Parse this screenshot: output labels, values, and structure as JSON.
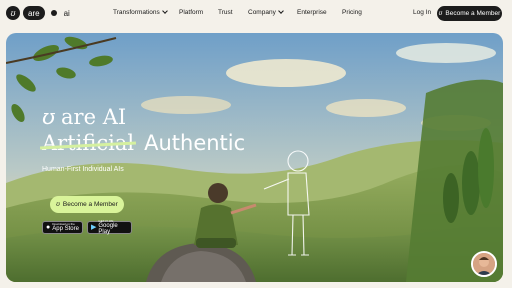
{
  "logo": {
    "mark": "ʊ",
    "word": "are",
    "suffix": "ai"
  },
  "nav": {
    "items": [
      {
        "label": "Transformations",
        "dropdown": true
      },
      {
        "label": "Platform",
        "dropdown": false
      },
      {
        "label": "Trust",
        "dropdown": false
      },
      {
        "label": "Company",
        "dropdown": true
      },
      {
        "label": "Enterprise",
        "dropdown": false
      },
      {
        "label": "Pricing",
        "dropdown": false
      }
    ],
    "login": "Log In",
    "cta": "Become a Member"
  },
  "hero": {
    "mark": "ʊ",
    "line1_rest": "are AI",
    "struck_word": "Artificial",
    "replacement_word": "Authentic",
    "subtitle": "Human-First Individual AIs",
    "cta": "Become a Member",
    "app_store": {
      "small": "Download on the",
      "big": "App Store"
    },
    "google_play": {
      "small": "GET IT ON",
      "big": "Google Play"
    }
  },
  "colors": {
    "accent": "#d9f49a",
    "dark": "#1c1c1c",
    "page_bg": "#f4f1ea"
  },
  "icons": [
    "logo-mark-icon",
    "chevron-down-icon",
    "apple-icon",
    "play-icon",
    "user-avatar"
  ]
}
